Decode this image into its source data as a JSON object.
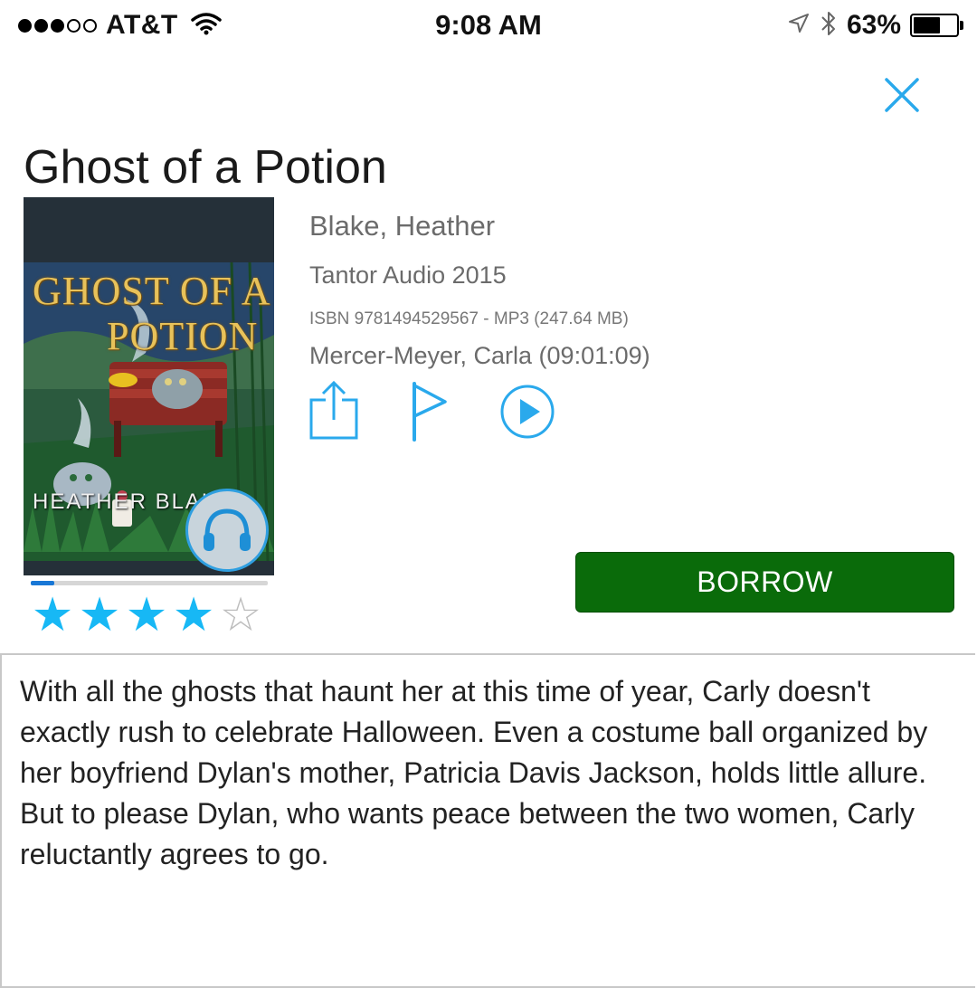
{
  "status_bar": {
    "carrier": "AT&T",
    "time": "9:08 AM",
    "battery_percent": "63%",
    "battery_level": 0.63,
    "signal_bars_filled": 3,
    "signal_bars_total": 5
  },
  "book": {
    "title": "Ghost of a Potion",
    "author": "Blake, Heather",
    "publisher_year": "Tantor Audio 2015",
    "isbn_format": "ISBN 9781494529567 - MP3 (247.64 MB)",
    "narrator_duration": "Mercer-Meyer, Carla (09:01:09)",
    "cover": {
      "title_line1": "GHOST OF A",
      "title_line2": "POTION",
      "author": "HEATHER BLAKE"
    },
    "progress": 0.1,
    "rating": 4,
    "rating_max": 5,
    "description": "With all the ghosts that haunt her at this time of year, Carly doesn't exactly rush to celebrate Halloween. Even a costume ball organized by her boyfriend Dylan's mother, Patricia Davis Jackson, holds little allure. But to please Dylan, who wants peace between the two women, Carly reluctantly agrees to go."
  },
  "actions": {
    "borrow_label": "BORROW",
    "icons": [
      "share-icon",
      "flag-icon",
      "play-icon"
    ]
  },
  "colors": {
    "accent": "#17b8f5",
    "borrow_bg": "#0a6b0a",
    "close": "#2aa9ec"
  }
}
